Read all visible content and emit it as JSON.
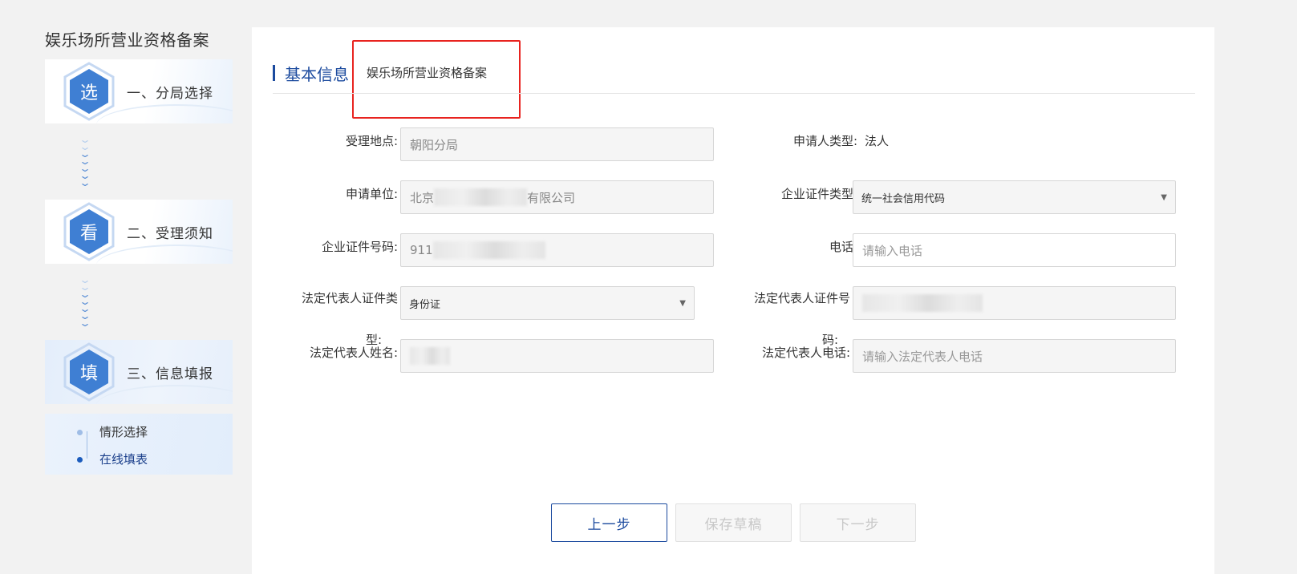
{
  "sidebar": {
    "title": "娱乐场所营业资格备案",
    "steps": [
      {
        "char": "选",
        "label": "一、分局选择",
        "active": false
      },
      {
        "char": "看",
        "label": "二、受理须知",
        "active": false
      },
      {
        "char": "填",
        "label": "三、信息填报",
        "active": true
      }
    ],
    "substeps": [
      {
        "label": "情形选择",
        "current": false
      },
      {
        "label": "在线填表",
        "current": true
      }
    ]
  },
  "main": {
    "section_title": "基本信息",
    "highlight_text": "娱乐场所营业资格备案",
    "fields": {
      "accept_location": {
        "label": "受理地点:",
        "value": "朝阳分局"
      },
      "applicant_type": {
        "label": "申请人类型:",
        "value": "法人"
      },
      "applicant_unit": {
        "label": "申请单位:",
        "value_prefix": "北京",
        "value_suffix": "有限公司"
      },
      "cert_type": {
        "label": "企业证件类型:",
        "value": "统一社会信用代码"
      },
      "cert_number": {
        "label": "企业证件号码:",
        "value_prefix": "911"
      },
      "phone": {
        "label": "电话:",
        "placeholder": "请输入电话"
      },
      "legal_id_type": {
        "label_line1": "法定代表人证件类",
        "label_line2": "型:",
        "value": "身份证"
      },
      "legal_id_number": {
        "label_line1": "法定代表人证件号",
        "label_line2": "码:"
      },
      "legal_name": {
        "label": "法定代表人姓名:"
      },
      "legal_phone": {
        "label": "法定代表人电话:",
        "placeholder": "请输入法定代表人电话"
      }
    },
    "buttons": {
      "prev": "上一步",
      "save_draft": "保存草稿",
      "next": "下一步"
    }
  }
}
